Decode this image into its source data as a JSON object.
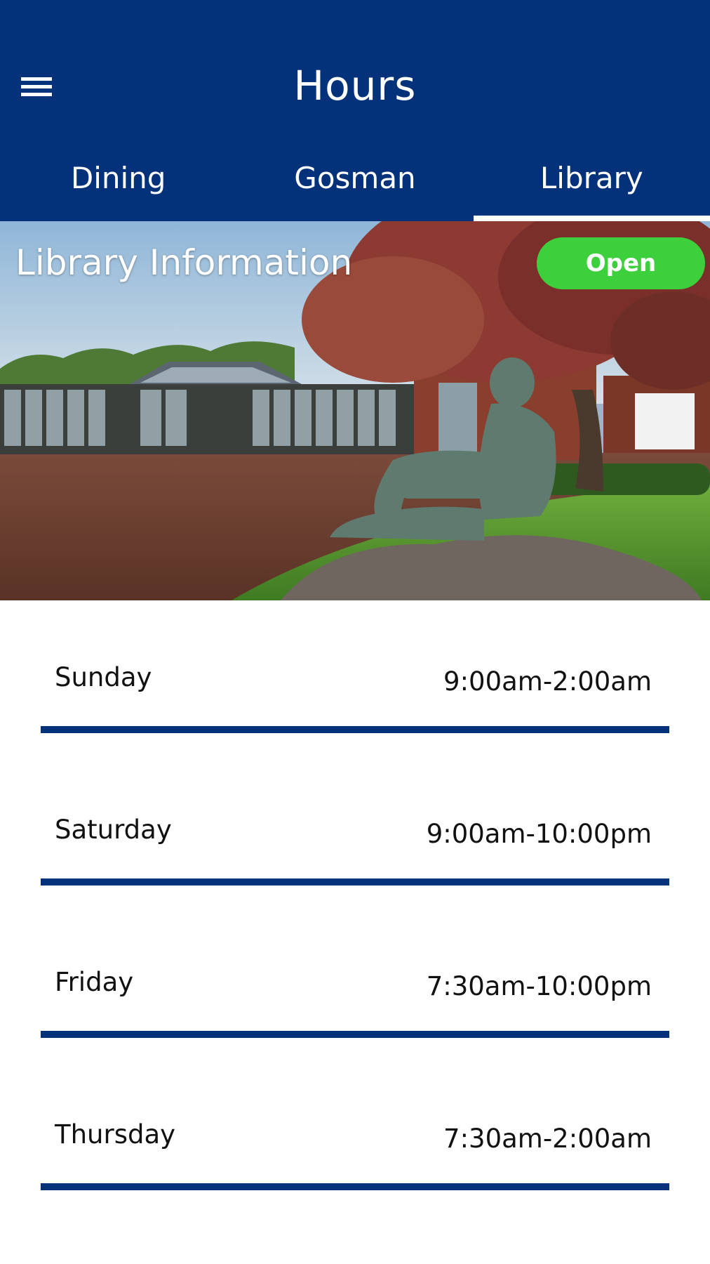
{
  "header": {
    "title": "Hours",
    "menu_icon": "hamburger-menu-icon"
  },
  "tabs": [
    {
      "label": "Dining",
      "active": false
    },
    {
      "label": "Gosman",
      "active": false
    },
    {
      "label": "Library",
      "active": true
    }
  ],
  "hero": {
    "title": "Library Information",
    "status": "Open",
    "status_color": "#3ecf3c"
  },
  "hours": [
    {
      "day": "Sunday",
      "time": "9:00am-2:00am"
    },
    {
      "day": "Saturday",
      "time": "9:00am-10:00pm"
    },
    {
      "day": "Friday",
      "time": "7:30am-10:00pm"
    },
    {
      "day": "Thursday",
      "time": "7:30am-2:00am"
    }
  ],
  "colors": {
    "brand": "#03317a",
    "background": "#ffffff",
    "open_badge": "#3ecf3c"
  }
}
